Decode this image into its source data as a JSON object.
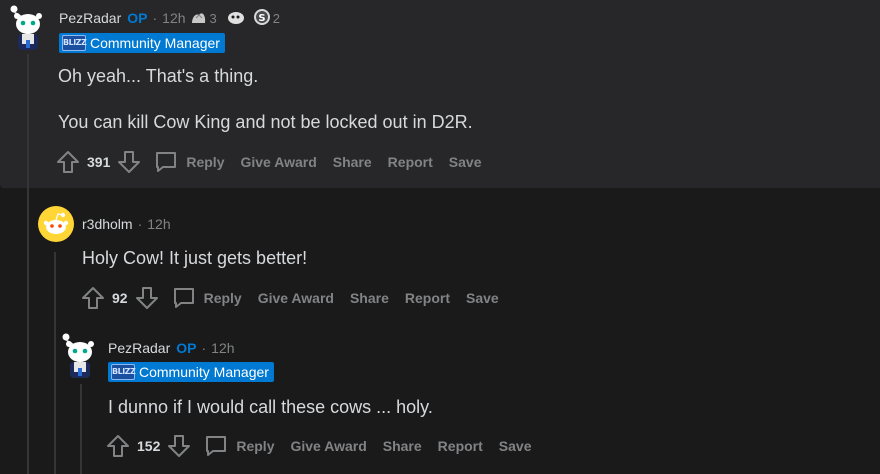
{
  "comments": [
    {
      "username": "PezRadar",
      "op_label": "OP",
      "time": "12h",
      "awards": [
        {
          "icon": "hands-award-icon",
          "count": "3"
        },
        {
          "icon": "moon-award-icon",
          "count": ""
        },
        {
          "icon": "coin-award-icon",
          "count": "2"
        }
      ],
      "flair": "Community Manager",
      "flair_logo": "BLIZZ",
      "paragraphs": [
        "Oh yeah... That's a thing.",
        "You can kill Cow King and not be locked out in D2R."
      ],
      "score": "391"
    },
    {
      "username": "r3dholm",
      "time": "12h",
      "paragraphs": [
        "Holy Cow! It just gets better!"
      ],
      "score": "92"
    },
    {
      "username": "PezRadar",
      "op_label": "OP",
      "time": "12h",
      "flair": "Community Manager",
      "flair_logo": "BLIZZ",
      "paragraphs": [
        "I dunno if I would call these cows ... holy."
      ],
      "score": "152"
    }
  ],
  "actions": {
    "reply": "Reply",
    "give_award": "Give Award",
    "share": "Share",
    "report": "Report",
    "save": "Save"
  },
  "separator": "·",
  "colors": {
    "background": "#1a1a1b",
    "highlight_panel": "#272729",
    "op_blue": "#0079d3",
    "flair_bg": "#0079d3",
    "muted_text": "#818384",
    "body_text": "#d7dadc",
    "snoo_yellow": "#ffd635"
  }
}
